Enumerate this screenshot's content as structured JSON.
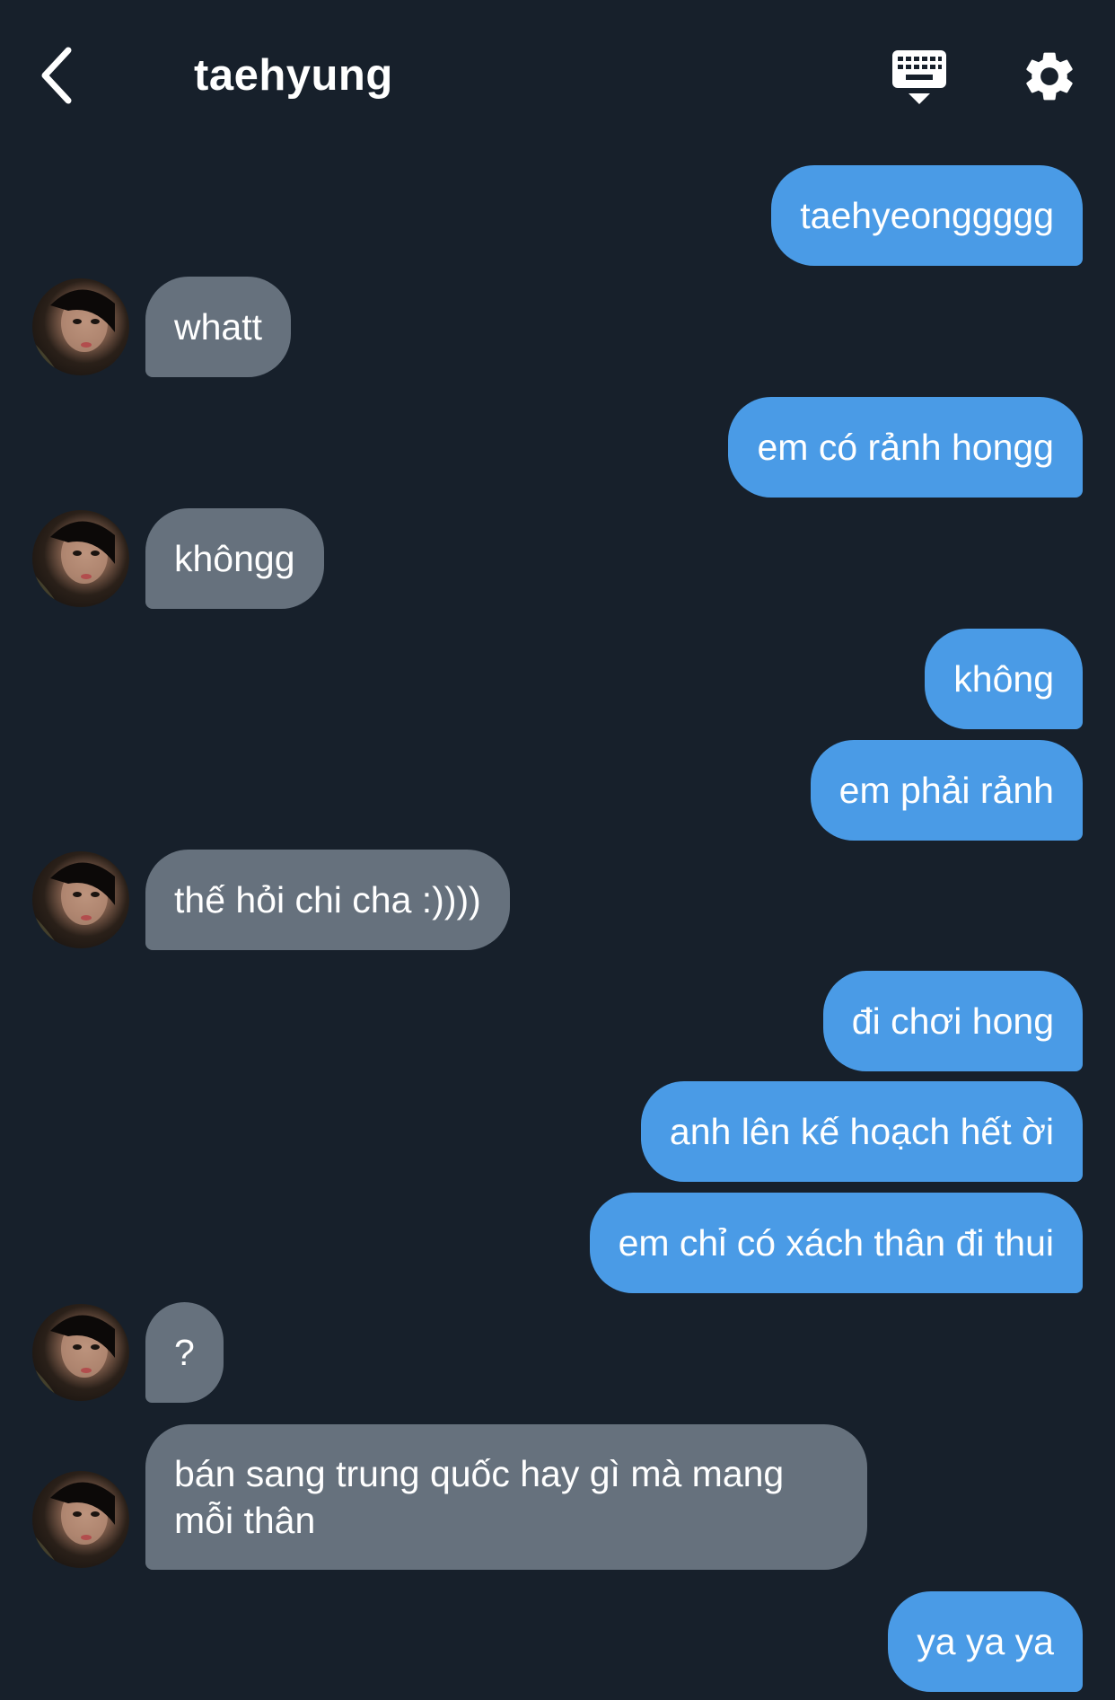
{
  "header": {
    "title": "taehyung",
    "back_icon": "chevron-left-icon",
    "keyboard_icon": "keyboard-icon",
    "settings_icon": "gear-icon"
  },
  "colors": {
    "background": "#17202b",
    "outgoing_bubble": "#4a9be6",
    "incoming_bubble": "#66717d"
  },
  "messages": [
    {
      "sender": "me",
      "text": "taehyeonggggg"
    },
    {
      "sender": "taehyung",
      "text": "whatt"
    },
    {
      "sender": "me",
      "text": "em có rảnh hongg"
    },
    {
      "sender": "taehyung",
      "text": "khôngg"
    },
    {
      "sender": "me",
      "text": "không"
    },
    {
      "sender": "me",
      "text": "em phải rảnh"
    },
    {
      "sender": "taehyung",
      "text": "thế hỏi chi cha :))))"
    },
    {
      "sender": "me",
      "text": "đi chơi hong"
    },
    {
      "sender": "me",
      "text": "anh lên kế hoạch hết ời"
    },
    {
      "sender": "me",
      "text": "em chỉ có xách thân đi thui"
    },
    {
      "sender": "taehyung",
      "text": "?"
    },
    {
      "sender": "taehyung",
      "text": "bán sang trung quốc hay gì mà mang mỗi thân"
    },
    {
      "sender": "me",
      "text": "ya ya ya"
    }
  ]
}
